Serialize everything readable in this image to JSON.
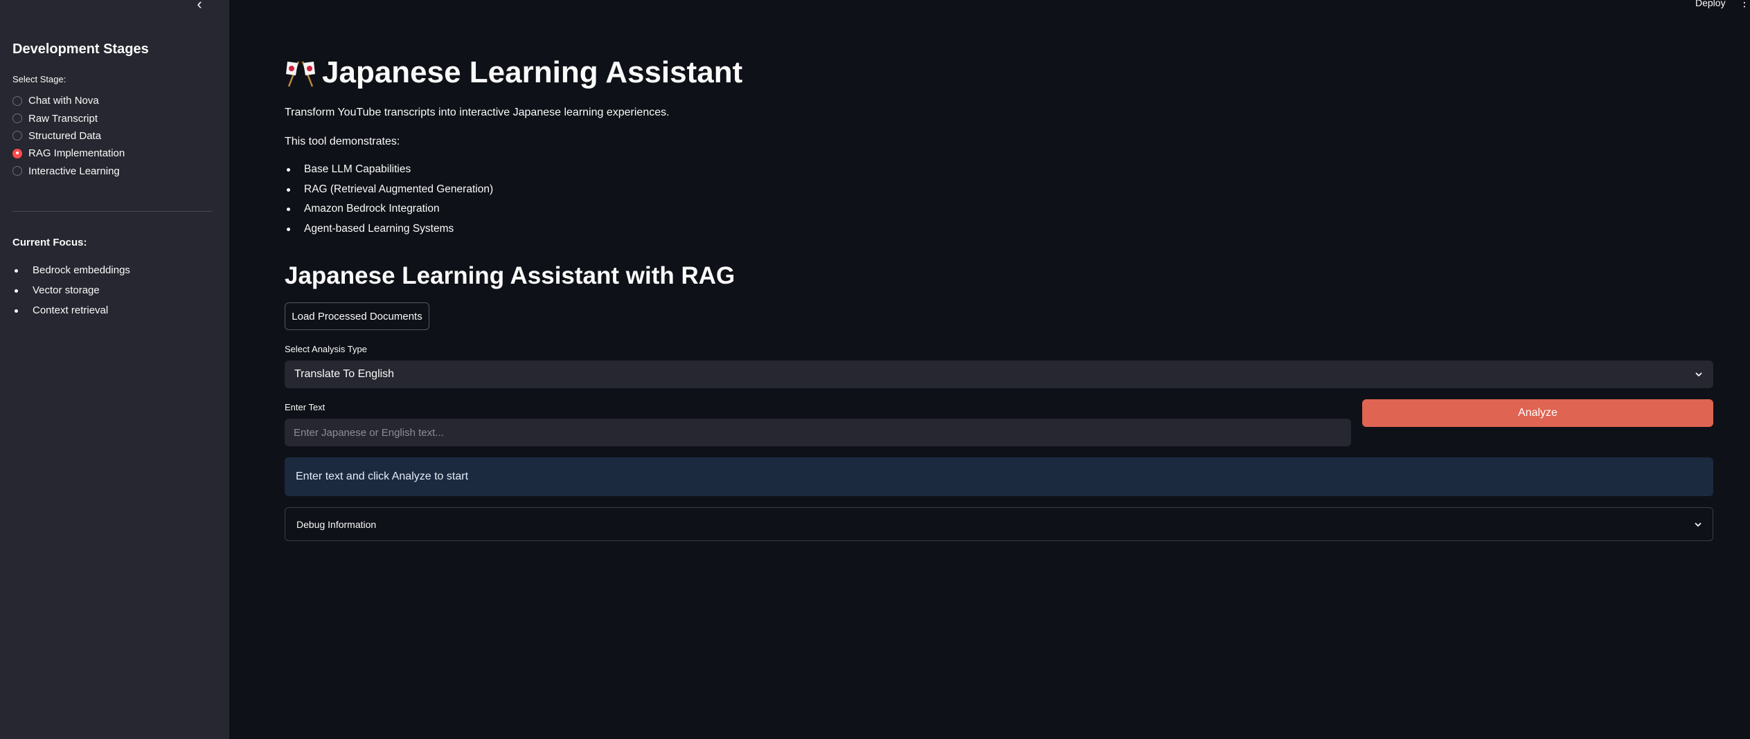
{
  "sidebar": {
    "collapse_glyph": "‹",
    "title": "Development Stages",
    "stage_label": "Select Stage:",
    "stages": [
      {
        "label": "Chat with Nova",
        "selected": false
      },
      {
        "label": "Raw Transcript",
        "selected": false
      },
      {
        "label": "Structured Data",
        "selected": false
      },
      {
        "label": "RAG Implementation",
        "selected": true
      },
      {
        "label": "Interactive Learning",
        "selected": false
      }
    ],
    "focus_title": "Current Focus:",
    "focus_items": [
      "Bedrock embeddings",
      "Vector storage",
      "Context retrieval"
    ]
  },
  "topbar": {
    "deploy_label": "Deploy",
    "menu_glyph": "⋮"
  },
  "main": {
    "title": "Japanese Learning Assistant",
    "title_icon": "crossed-flags-icon",
    "intro": "Transform YouTube transcripts into interactive Japanese learning experiences.",
    "demo_label": "This tool demonstrates:",
    "capabilities": [
      "Base LLM Capabilities",
      "RAG (Retrieval Augmented Generation)",
      "Amazon Bedrock Integration",
      "Agent-based Learning Systems"
    ],
    "section_title": "Japanese Learning Assistant with RAG",
    "load_button": "Load Processed Documents",
    "analysis_label": "Select Analysis Type",
    "analysis_value": "Translate To English",
    "text_label": "Enter Text",
    "text_placeholder": "Enter Japanese or English text...",
    "analyze_button": "Analyze",
    "info_message": "Enter text and click Analyze to start",
    "debug_label": "Debug Information"
  },
  "colors": {
    "background": "#0e1117",
    "sidebar": "#262730",
    "accent": "#ff4b4b",
    "analyze_button": "#e06452",
    "info_box": "#1c2a40"
  }
}
